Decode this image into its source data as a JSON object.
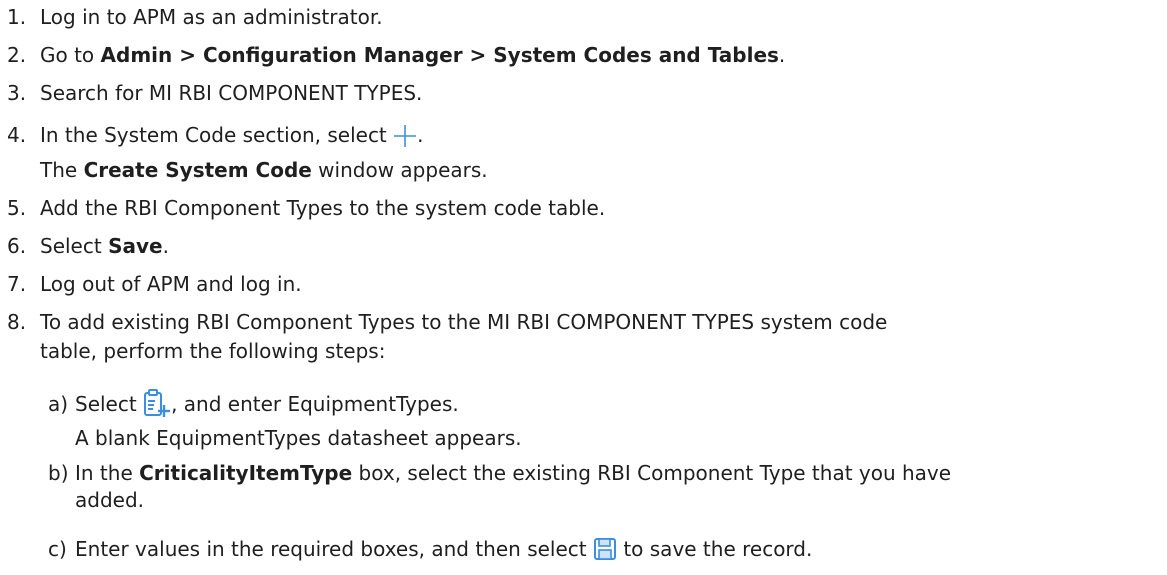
{
  "steps": [
    {
      "num": "1.",
      "text": "Log in to APM as an administrator."
    },
    {
      "num": "2.",
      "pre": "Go to ",
      "bold": "Admin > Configuration Manager > System Codes and Tables",
      "post": "."
    },
    {
      "num": "3.",
      "text": "Search for MI RBI COMPONENT TYPES."
    },
    {
      "num": "4.",
      "pre": "In the System Code section, select ",
      "post": ".",
      "icon": "plus-icon",
      "result_pre": "The ",
      "result_bold": "Create System Code",
      "result_post": " window appears."
    },
    {
      "num": "5.",
      "text": "Add the RBI Component Types to the system code table."
    },
    {
      "num": "6.",
      "pre": "Select ",
      "bold": "Save",
      "post": "."
    },
    {
      "num": "7.",
      "text": "Log out of APM and log in."
    },
    {
      "num": "8.",
      "line1": "To add existing RBI Component Types to the MI RBI COMPONENT TYPES system code",
      "line2": "table, perform the following steps:"
    }
  ],
  "substeps": [
    {
      "letter": "a)",
      "pre": "Select ",
      "icon": "new-record-icon",
      "post": ", and enter EquipmentTypes.",
      "result": "A blank EquipmentTypes datasheet appears."
    },
    {
      "letter": "b)",
      "pre": "In the ",
      "bold": "CriticalityItemType",
      "post": " box, select the existing RBI Component Type that you have",
      "line2": "added."
    },
    {
      "letter": "c)",
      "pre": "Enter values in the required boxes, and then select ",
      "icon": "save-icon",
      "post": " to save the record."
    }
  ],
  "colors": {
    "icon_blue": "#3b8fe0",
    "text": "#1f1f1f"
  }
}
